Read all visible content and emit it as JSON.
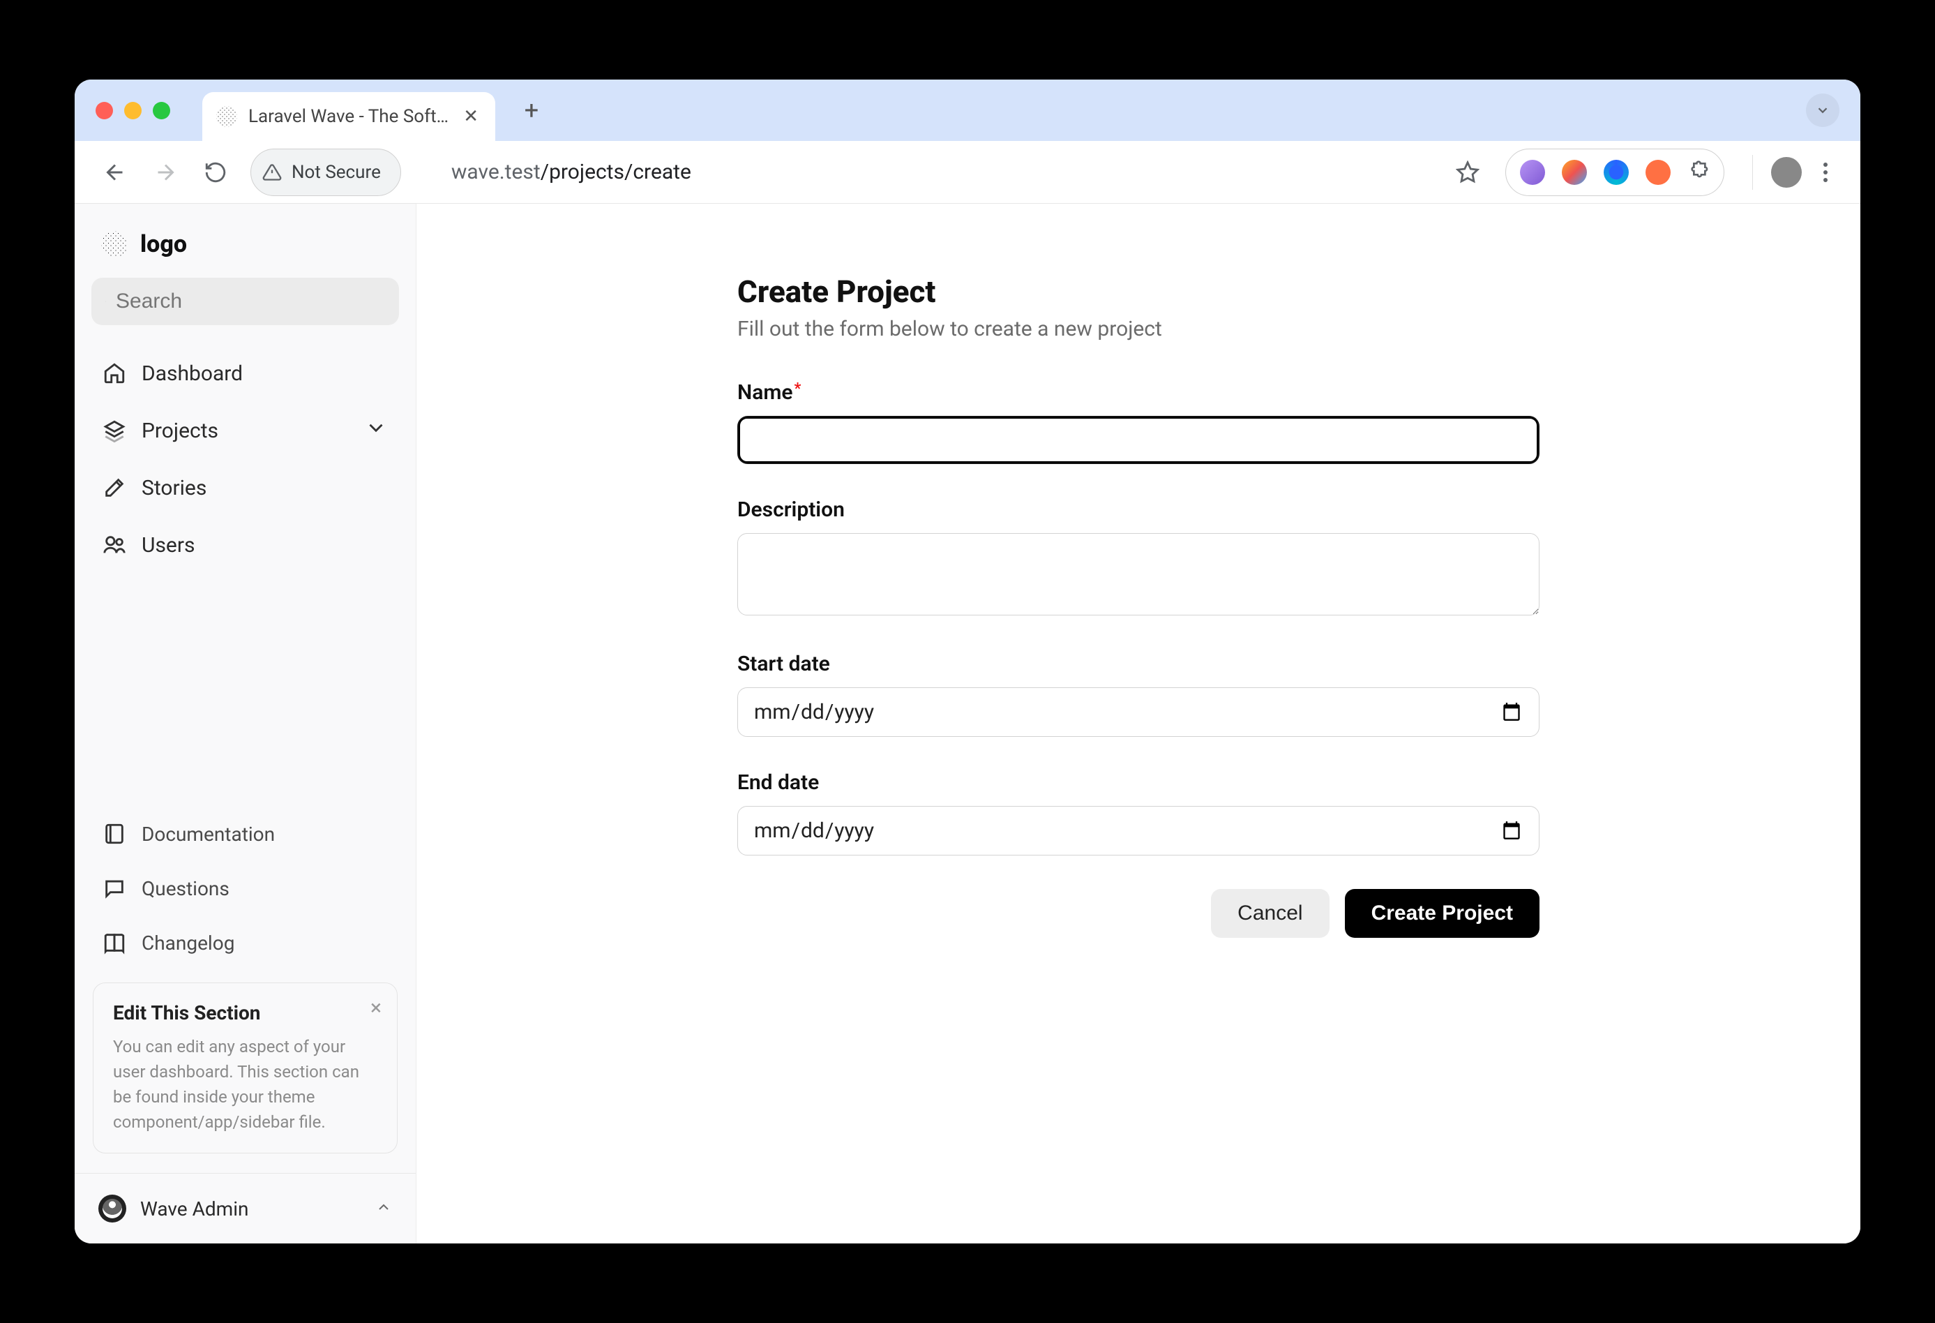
{
  "browser": {
    "tab_title": "Laravel Wave - The Software",
    "url_host": "wave.test",
    "url_path": "/projects/create",
    "not_secure_label": "Not Secure"
  },
  "sidebar": {
    "logo_text": "logo",
    "search_placeholder": "Search",
    "nav": [
      {
        "label": "Dashboard"
      },
      {
        "label": "Projects",
        "expandable": true
      },
      {
        "label": "Stories"
      },
      {
        "label": "Users"
      }
    ],
    "footer_links": [
      {
        "label": "Documentation"
      },
      {
        "label": "Questions"
      },
      {
        "label": "Changelog"
      }
    ],
    "info_card": {
      "title": "Edit This Section",
      "body": "You can edit any aspect of your user dashboard. This section can be found inside your theme component/app/sidebar file."
    },
    "user": {
      "name": "Wave Admin"
    }
  },
  "main": {
    "title": "Create Project",
    "subtitle": "Fill out the form below to create a new project",
    "fields": {
      "name": {
        "label": "Name",
        "value": ""
      },
      "description": {
        "label": "Description",
        "value": ""
      },
      "start_date": {
        "label": "Start date",
        "placeholder": "mm/dd/yyyy"
      },
      "end_date": {
        "label": "End date",
        "placeholder": "mm/dd/yyyy"
      }
    },
    "buttons": {
      "cancel": "Cancel",
      "submit": "Create Project"
    }
  }
}
